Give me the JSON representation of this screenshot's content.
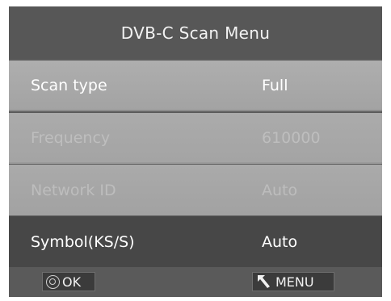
{
  "menu": {
    "title": "DVB-C Scan Menu",
    "rows": [
      {
        "label": "Scan type",
        "value": "Full",
        "state": "selected"
      },
      {
        "label": "Frequency",
        "value": "610000",
        "state": "disabled"
      },
      {
        "label": "Network ID",
        "value": "Auto",
        "state": "disabled"
      },
      {
        "label": "Symbol(KS/S)",
        "value": "Auto",
        "state": "normal"
      }
    ]
  },
  "footer": {
    "ok_label": "OK",
    "menu_label": "MENU",
    "ok_icon": "ok-circle-icon",
    "menu_icon": "back-arrow-icon"
  },
  "colors": {
    "selected_row": "#aeaeae",
    "disabled_text": "#bdbdbd",
    "dark_row": "#474747"
  }
}
